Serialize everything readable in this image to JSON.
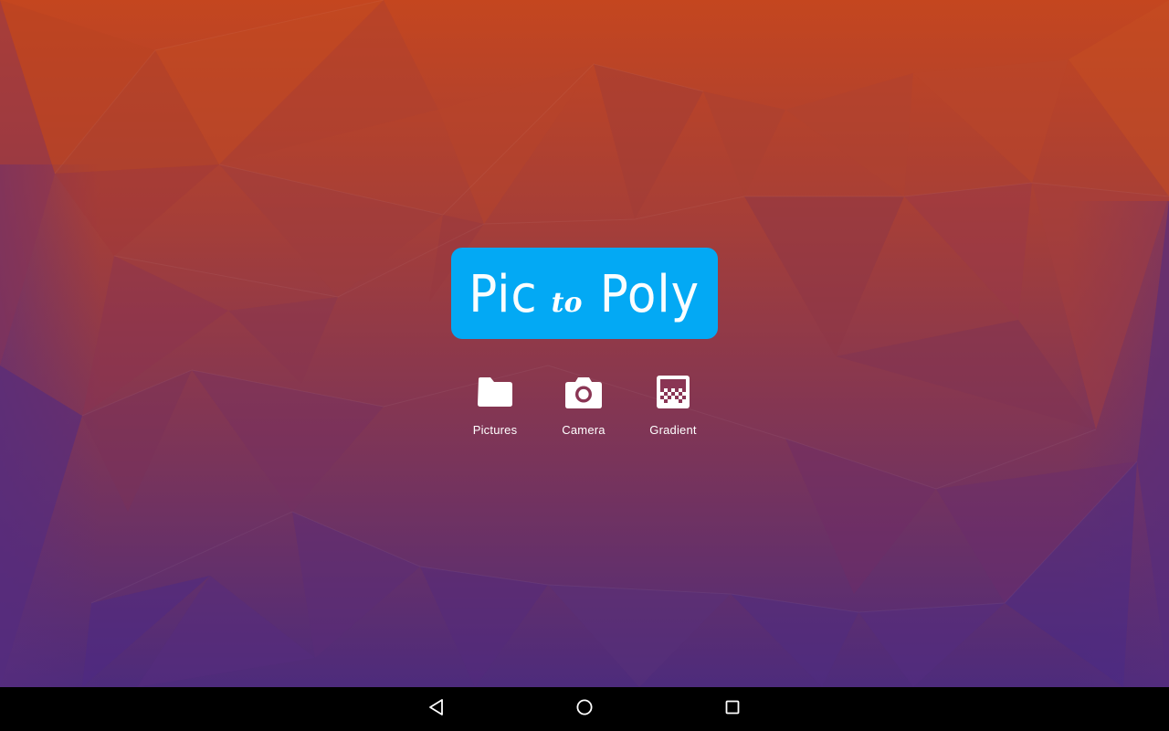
{
  "app": {
    "logo": {
      "word1": "Pic",
      "connector": "to",
      "word2": "Poly"
    },
    "actions": [
      {
        "label": "Pictures",
        "icon": "folder-icon"
      },
      {
        "label": "Camera",
        "icon": "camera-icon"
      },
      {
        "label": "Gradient",
        "icon": "gradient-icon"
      }
    ]
  },
  "navbar": {
    "buttons": [
      {
        "icon": "back-icon"
      },
      {
        "icon": "home-icon"
      },
      {
        "icon": "recents-icon"
      }
    ]
  },
  "colors": {
    "logo_background": "#03a9f4",
    "wallpaper_top": "#c8481e",
    "wallpaper_bottom": "#4b2a7e",
    "navbar": "#000000",
    "text": "#ffffff"
  }
}
